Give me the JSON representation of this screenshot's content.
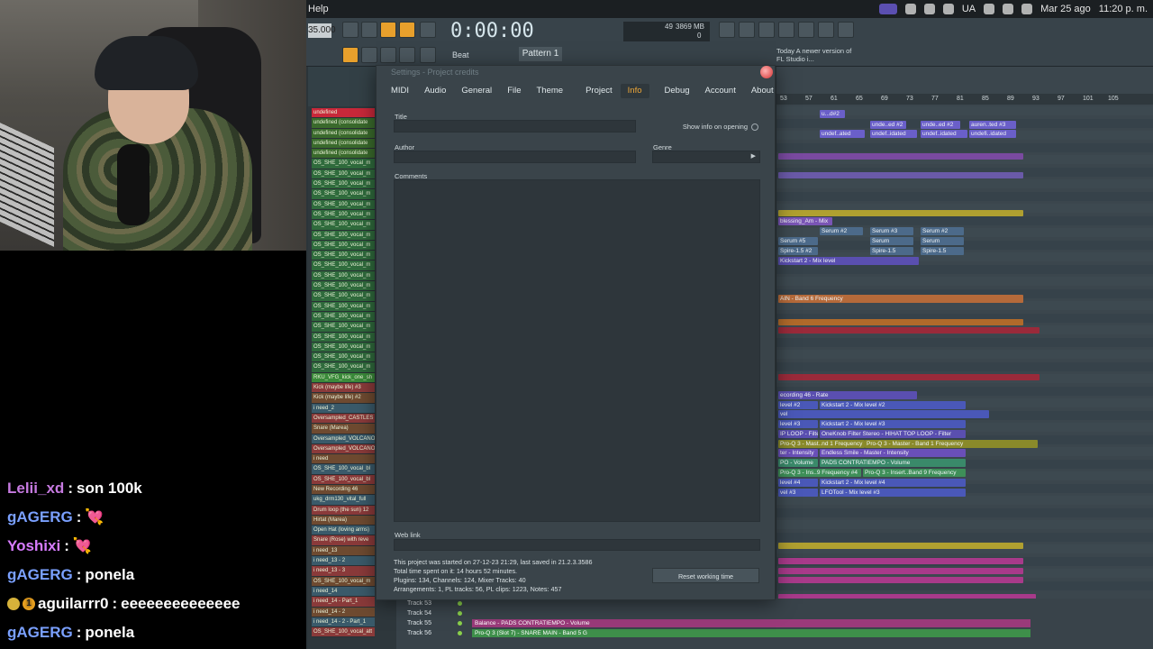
{
  "menubar": {
    "help": "Help",
    "lang": "UA",
    "date": "Mar 25 ago",
    "time": "11:20 p. m."
  },
  "toolbar": {
    "tempo": "35.000",
    "time": "0:00:00",
    "cpu": "49",
    "mem": "3869 MB",
    "poly": "0",
    "beat_label": "Beat",
    "pattern": "Pattern 1",
    "hint": "Today  A newer version of FL Studio i..."
  },
  "browser_items": [
    "undefined",
    "undefined (consolidate",
    "undefined (consolidate",
    "undefined (consolidate",
    "undefined (consolidate",
    "OS_SHE_100_vocal_m",
    "OS_SHE_100_vocal_m",
    "OS_SHE_100_vocal_m",
    "OS_SHE_100_vocal_m",
    "OS_SHE_100_vocal_m",
    "OS_SHE_100_vocal_m",
    "OS_SHE_100_vocal_m",
    "OS_SHE_100_vocal_m",
    "OS_SHE_100_vocal_m",
    "OS_SHE_100_vocal_m",
    "OS_SHE_100_vocal_m",
    "OS_SHE_100_vocal_m",
    "OS_SHE_100_vocal_m",
    "OS_SHE_100_vocal_m",
    "OS_SHE_100_vocal_m",
    "OS_SHE_100_vocal_m",
    "OS_SHE_100_vocal_m",
    "OS_SHE_100_vocal_m",
    "OS_SHE_100_vocal_m",
    "OS_SHE_100_vocal_m",
    "OS_SHE_100_vocal_m",
    "RKU_VFG_kick_one_sh",
    "Kick (maybe life) #3",
    "Kick (maybe life) #2",
    "i need_2",
    "Oversampled_CASTLES",
    "Snare (Marea)",
    "Oversampled_VOLCANO",
    "Oversampled_VOLCANO",
    "i need",
    "OS_SHE_100_vocal_bl",
    "OS_SHE_100_vocal_bl",
    "New Recording 46",
    "ukg_drm130_vital_full",
    "Drum loop (the sun) 12",
    "Hirtat (Marea)",
    "Open Hat (loving arms)",
    "Snare (Rose) with reve",
    "i need_13",
    "i need_13 - 2",
    "i need_13 - 3",
    "OS_SHE_100_vocal_m",
    "i need_14",
    "i need_14 - Part_1",
    "i need_14 - 2",
    "i need_14 - 2 - Part_1",
    "OS_SHE_100_vocal_att"
  ],
  "dialog": {
    "title": "Settings - Project credits",
    "tabs": [
      "MIDI",
      "Audio",
      "General",
      "File",
      "Theme",
      "Project",
      "Info",
      "Debug",
      "Account",
      "About"
    ],
    "active_tab": "Info",
    "title_label": "Title",
    "author_label": "Author",
    "genre_label": "Genre",
    "show_info": "Show info on opening",
    "comments_label": "Comments",
    "weblink_label": "Web link",
    "stats": [
      "This project was started on 27-12-23 21:29, last saved in 21.2.3.3586",
      "Total time spent on it:  14 hours 52 minutes.",
      "Plugins: 134, Channels: 124, Mixer Tracks: 40",
      "Arrangements: 1, PL tracks: 56, PL clips: 1223, Notes: 457"
    ],
    "reset_button": "Reset working time"
  },
  "playlist": {
    "ruler": [
      "53",
      "57",
      "61",
      "65",
      "69",
      "73",
      "77",
      "81",
      "85",
      "89",
      "93",
      "97",
      "101",
      "105"
    ],
    "clips": [
      {
        "t": "u...d#2",
        "c": "#6a5fc9"
      },
      {
        "t": "unde..ed #2",
        "c": "#6a5fc9"
      },
      {
        "t": "unde..ed #2",
        "c": "#6a5fc9"
      },
      {
        "t": "auren..ted #3",
        "c": "#6a5fc9"
      },
      {
        "t": "undef..ated",
        "c": "#6a5fc9"
      },
      {
        "t": "undef..idated",
        "c": "#6a5fc9"
      },
      {
        "t": "undef..idated",
        "c": "#6a5fc9"
      },
      {
        "t": "undefi..idated",
        "c": "#6a5fc9"
      },
      {
        "t": "blessing_Am - Mix",
        "c": "#7a55b5"
      },
      {
        "t": "Serum #2",
        "c": "#4c6a8a"
      },
      {
        "t": "Serum #3",
        "c": "#4c6a8a"
      },
      {
        "t": "Serum #2",
        "c": "#4c6a8a"
      },
      {
        "t": "Serum #5",
        "c": "#4c6a8a"
      },
      {
        "t": "Serum",
        "c": "#4c6a8a"
      },
      {
        "t": "Serum",
        "c": "#4c6a8a"
      },
      {
        "t": "Spire-1.5 #2",
        "c": "#4c6a8a"
      },
      {
        "t": "Spire-1.5",
        "c": "#4c6a8a"
      },
      {
        "t": "Spire-1.5",
        "c": "#4c6a8a"
      },
      {
        "t": "Kickstart 2 - Mix level",
        "c": "#5a4fb0"
      },
      {
        "t": "AIN - Band 6 Frequency",
        "c": "#b56a3a"
      },
      {
        "t": "ecording 46 - Rate",
        "c": "#5a4fb0"
      },
      {
        "t": "level #2",
        "c": "#4a58b8"
      },
      {
        "t": "Kickstart 2 - Mix level #2",
        "c": "#4a58b8"
      },
      {
        "t": "vel",
        "c": "#4a58b8"
      },
      {
        "t": "level #3",
        "c": "#4a58b8"
      },
      {
        "t": "Kickstart 2 - Mix level #3",
        "c": "#4a58b8"
      },
      {
        "t": "IP LOOP - Filter",
        "c": "#5a4fb0"
      },
      {
        "t": "OneKnob Filter Stereo - HIHAT TOP LOOP - Filter",
        "c": "#5a4fb0"
      },
      {
        "t": "Pro-Q 3 - Mast..nd 1 Frequency",
        "c": "#8a8a2a"
      },
      {
        "t": "Pro-Q 3 - Master - Band 1 Frequency",
        "c": "#8a8a2a"
      },
      {
        "t": "ter - Intensity",
        "c": "#6a4fb8"
      },
      {
        "t": "Endless Smile - Master - Intensity",
        "c": "#6a4fb8"
      },
      {
        "t": "PO - Volume",
        "c": "#3a8a6a"
      },
      {
        "t": "PADS CONTRATIEMPO - Volume",
        "c": "#3a8a6a"
      },
      {
        "t": "Pro-Q 3 - Ins..9 Frequency #4",
        "c": "#3e8f58"
      },
      {
        "t": "Pro-Q 3 - Insert..Band 9 Frequency",
        "c": "#3e8f58"
      },
      {
        "t": "level #4",
        "c": "#4a58b8"
      },
      {
        "t": "Kickstart 2 - Mix level #4",
        "c": "#4a58b8"
      },
      {
        "t": "vel #3",
        "c": "#4a58b8"
      },
      {
        "t": "LFOTool - Mix level #3",
        "c": "#4a58b8"
      }
    ]
  },
  "bottom_tracks": [
    {
      "name": "Track 53",
      "clip": ""
    },
    {
      "name": "Track 54",
      "clip": ""
    },
    {
      "name": "Track 55",
      "clip": "Balance - PADS CONTRATIEMPO - Volume"
    },
    {
      "name": "Track 56",
      "clip": "Pro-Q 3 (Slot 7) - SNARE MAIN - Band 5 G"
    }
  ],
  "chat": [
    {
      "user": "Lelii_xd",
      "msg": "son 100k",
      "color": "#c67ae0",
      "badge": ""
    },
    {
      "user": "gAGERG",
      "msg": "💘",
      "color": "#7aa0ff",
      "badge": ""
    },
    {
      "user": "Yoshixi",
      "msg": "💘",
      "color": "#d77cff",
      "badge": ""
    },
    {
      "user": "gAGERG",
      "msg": "ponela",
      "color": "#7aa0ff",
      "badge": ""
    },
    {
      "user": "aguilarrr0",
      "msg": "eeeeeeeeeeeeee",
      "color": "#ffffff",
      "badge": "1"
    },
    {
      "user": "gAGERG",
      "msg": "ponela",
      "color": "#7aa0ff",
      "badge": ""
    }
  ],
  "colors": {
    "accent_orange": "#f0a838",
    "fl_bg": "#2b3439"
  }
}
